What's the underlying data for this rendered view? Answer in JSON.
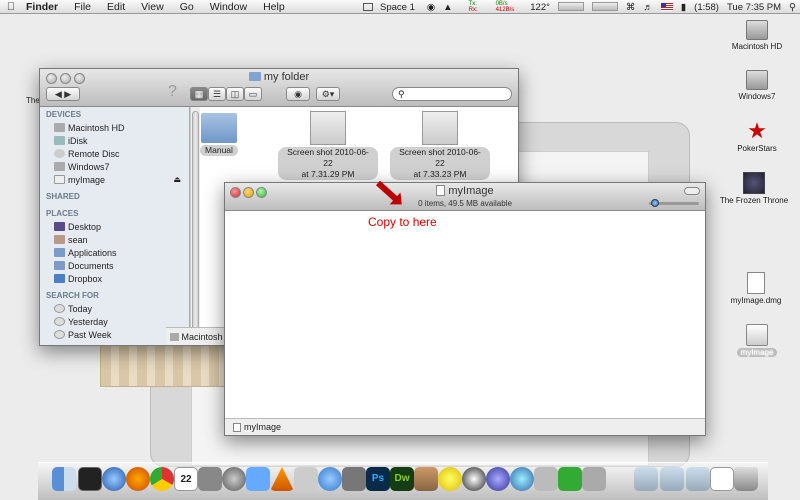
{
  "menubar": {
    "app_name": "Finder",
    "menus": [
      "File",
      "Edit",
      "View",
      "Go",
      "Window",
      "Help"
    ],
    "space": "Space 1",
    "net_tx_label": "Tx:",
    "net_rx_label": "Rx:",
    "net_tx": "0B/s",
    "net_rx": "412B/s",
    "temp": "122°",
    "battery": "(1:58)",
    "clock": "Tue 7:35 PM"
  },
  "back_window": {
    "title": "my folder",
    "sidebar": {
      "devices_header": "DEVICES",
      "devices": [
        "Macintosh HD",
        "iDisk",
        "Remote Disc",
        "Windows7",
        "myImage"
      ],
      "shared_header": "SHARED",
      "places_header": "PLACES",
      "places": [
        "Desktop",
        "sean",
        "Applications",
        "Documents",
        "Dropbox"
      ],
      "search_header": "SEARCH FOR",
      "search_for": [
        "Today",
        "Yesterday",
        "Past Week"
      ]
    },
    "files": [
      {
        "name": "Manual"
      },
      {
        "name": "Screen shot 2010-06-22",
        "name2": "at 7.31.29 PM"
      },
      {
        "name": "Screen shot 2010-06-22",
        "name2": "at 7.33.23 PM"
      }
    ],
    "path_bar": "Macintosh HD",
    "left_edge_text": "The"
  },
  "front_window": {
    "title": "myImage",
    "status": "0 items, 49.5 MB available",
    "annotation": "Copy to here",
    "path_bar": "myImage"
  },
  "desktop_icons": [
    {
      "name": "Macintosh HD"
    },
    {
      "name": "Windows7"
    },
    {
      "name": "PokerStars"
    },
    {
      "name": "The Frozen Throne"
    },
    {
      "name": "myImage.dmg"
    },
    {
      "name": "myImage"
    }
  ],
  "dock": {
    "calendar_day": "22",
    "ps_label": "Ps",
    "dw_label": "Dw"
  },
  "colors": {
    "annotation": "#e00000",
    "arrow": "#b00000"
  }
}
